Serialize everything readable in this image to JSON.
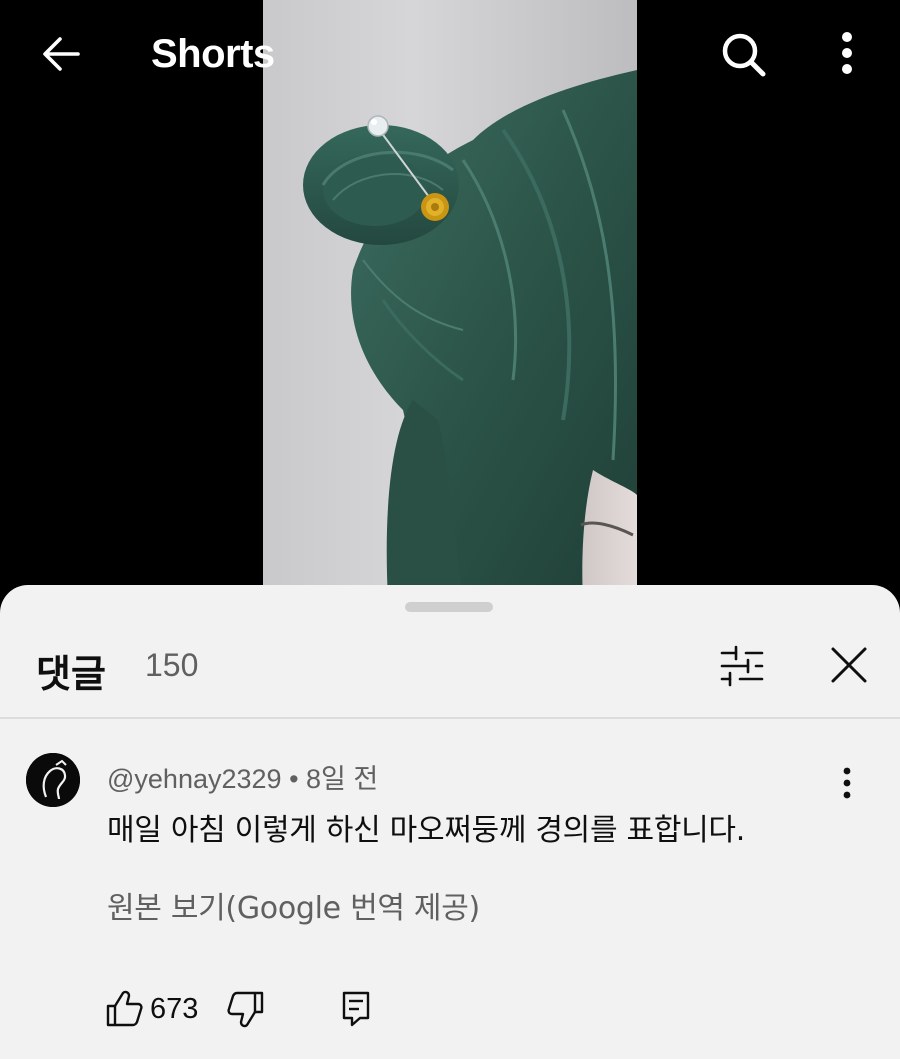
{
  "header": {
    "title": "Shorts",
    "back_icon": "arrow-left-icon",
    "search_icon": "search-icon",
    "more_icon": "more-vert-icon"
  },
  "video": {
    "description": "green-hair-bun-video",
    "hair_color": "#2f5a4f",
    "background_color": "#d0d0d2"
  },
  "comments": {
    "title": "댓글",
    "count": "150",
    "filter_icon": "sort-filter-icon",
    "close_icon": "close-icon",
    "items": [
      {
        "author": "@yehnay2329",
        "separator": "•",
        "time": "8일 전",
        "text": "매일 아침 이렇게 하신 마오쩌둥께 경의를 표합니다.",
        "translation_note": "원본 보기(Google 번역 제공)",
        "likes": "673",
        "like_icon": "thumbs-up-icon",
        "dislike_icon": "thumbs-down-icon",
        "reply_icon": "reply-comment-icon",
        "more_icon": "more-vert-icon"
      }
    ]
  },
  "colors": {
    "sheet_bg": "#f2f2f2",
    "primary_text": "#0f0f0f",
    "secondary_text": "#606060",
    "accent_gold": "#d4a017"
  }
}
